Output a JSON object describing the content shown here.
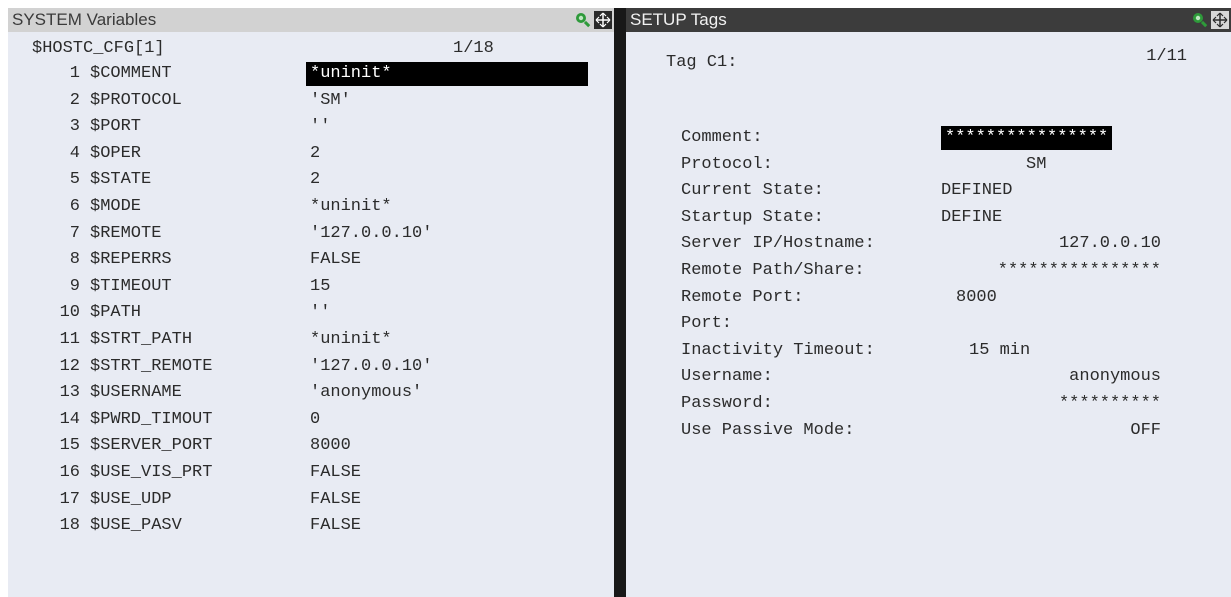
{
  "system_variables": {
    "title": "SYSTEM Variables",
    "header_name": "$HOSTC_CFG[1]",
    "page": "1/18",
    "rows": [
      {
        "idx": "1",
        "name": "$COMMENT",
        "value": "*uninit*"
      },
      {
        "idx": "2",
        "name": "$PROTOCOL",
        "value": "'SM'"
      },
      {
        "idx": "3",
        "name": "$PORT",
        "value": "''"
      },
      {
        "idx": "4",
        "name": "$OPER",
        "value": "2"
      },
      {
        "idx": "5",
        "name": "$STATE",
        "value": "2"
      },
      {
        "idx": "6",
        "name": "$MODE",
        "value": "*uninit*"
      },
      {
        "idx": "7",
        "name": "$REMOTE",
        "value": "'127.0.0.10'"
      },
      {
        "idx": "8",
        "name": "$REPERRS",
        "value": "FALSE"
      },
      {
        "idx": "9",
        "name": "$TIMEOUT",
        "value": "15"
      },
      {
        "idx": "10",
        "name": "$PATH",
        "value": "''"
      },
      {
        "idx": "11",
        "name": "$STRT_PATH",
        "value": "*uninit*"
      },
      {
        "idx": "12",
        "name": "$STRT_REMOTE",
        "value": "'127.0.0.10'"
      },
      {
        "idx": "13",
        "name": "$USERNAME",
        "value": "'anonymous'"
      },
      {
        "idx": "14",
        "name": "$PWRD_TIMOUT",
        "value": "0"
      },
      {
        "idx": "15",
        "name": "$SERVER_PORT",
        "value": "8000"
      },
      {
        "idx": "16",
        "name": "$USE_VIS_PRT",
        "value": "FALSE"
      },
      {
        "idx": "17",
        "name": "$USE_UDP",
        "value": "FALSE"
      },
      {
        "idx": "18",
        "name": "$USE_PASV",
        "value": "FALSE"
      }
    ]
  },
  "setup_tags": {
    "title": "SETUP Tags",
    "page": "1/11",
    "tag_label": "Tag C1:",
    "rows": [
      {
        "label": "Comment:",
        "value": "****************"
      },
      {
        "label": "Protocol:",
        "value": "SM"
      },
      {
        "label": "Current State:",
        "value": "DEFINED"
      },
      {
        "label": "Startup State:",
        "value": "DEFINE"
      },
      {
        "label": "Server IP/Hostname:",
        "value": "127.0.0.10"
      },
      {
        "label": "Remote Path/Share:",
        "value": "****************"
      },
      {
        "label": "Remote Port:",
        "value": "8000"
      },
      {
        "label": "Port:",
        "value": ""
      },
      {
        "label": "Inactivity Timeout:",
        "value": "15 min"
      },
      {
        "label": "Username:",
        "value": "anonymous"
      },
      {
        "label": "Password:",
        "value": "**********"
      },
      {
        "label": "Use Passive Mode:",
        "value": "OFF"
      }
    ]
  },
  "icons": {
    "zoom": "magnifier-icon",
    "maximize": "maximize-icon"
  },
  "colors": {
    "pane_bg": "#e8ebf3",
    "left_titlebar": "#d2d2d2",
    "right_titlebar": "#3c3c3c",
    "selection": "#000000",
    "icon_green": "#2e9a3a"
  }
}
